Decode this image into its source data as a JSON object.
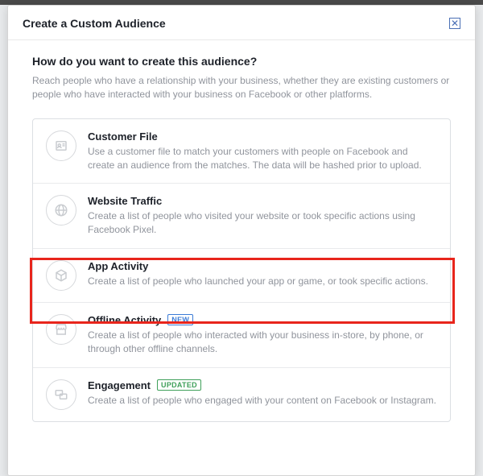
{
  "header": {
    "title": "Create a Custom Audience"
  },
  "body": {
    "question": "How do you want to create this audience?",
    "subtext": "Reach people who have a relationship with your business, whether they are existing customers or people who have interacted with your business on Facebook or other platforms."
  },
  "options": {
    "customer_file": {
      "title": "Customer File",
      "desc": "Use a customer file to match your customers with people on Facebook and create an audience from the matches. The data will be hashed prior to upload."
    },
    "website_traffic": {
      "title": "Website Traffic",
      "desc": "Create a list of people who visited your website or took specific actions using Facebook Pixel."
    },
    "app_activity": {
      "title": "App Activity",
      "desc": "Create a list of people who launched your app or game, or took specific actions."
    },
    "offline_activity": {
      "title": "Offline Activity",
      "badge": "NEW",
      "desc": "Create a list of people who interacted with your business in-store, by phone, or through other offline channels."
    },
    "engagement": {
      "title": "Engagement",
      "badge": "UPDATED",
      "desc": "Create a list of people who engaged with your content on Facebook or Instagram."
    }
  }
}
